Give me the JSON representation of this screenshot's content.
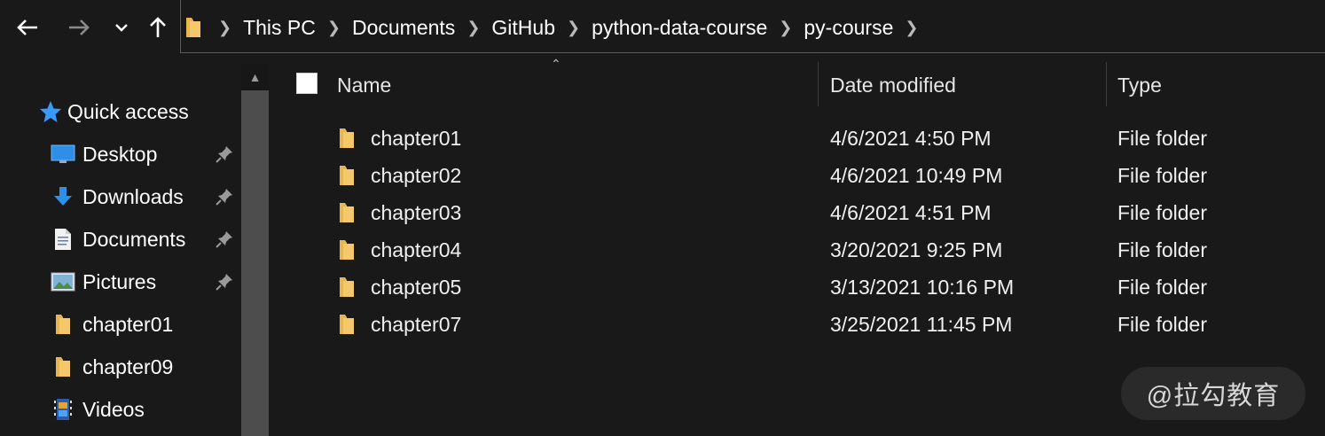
{
  "nav": {
    "back_icon": "back-arrow-icon",
    "forward_icon": "forward-arrow-icon",
    "recent_icon": "chevron-down-icon",
    "up_icon": "up-arrow-icon"
  },
  "breadcrumb": [
    "This PC",
    "Documents",
    "GitHub",
    "python-data-course",
    "py-course"
  ],
  "sidebar": {
    "quick_access": "Quick access",
    "items": [
      {
        "label": "Desktop",
        "icon": "desktop-icon",
        "pinned": true
      },
      {
        "label": "Downloads",
        "icon": "downloads-icon",
        "pinned": true
      },
      {
        "label": "Documents",
        "icon": "documents-icon",
        "pinned": true
      },
      {
        "label": "Pictures",
        "icon": "pictures-icon",
        "pinned": true
      },
      {
        "label": "chapter01",
        "icon": "folder-icon",
        "pinned": false
      },
      {
        "label": "chapter09",
        "icon": "folder-icon",
        "pinned": false
      },
      {
        "label": "Videos",
        "icon": "videos-icon",
        "pinned": false
      }
    ]
  },
  "columns": {
    "name": "Name",
    "date": "Date modified",
    "type": "Type"
  },
  "files": [
    {
      "name": "chapter01",
      "date": "4/6/2021 4:50 PM",
      "type": "File folder"
    },
    {
      "name": "chapter02",
      "date": "4/6/2021 10:49 PM",
      "type": "File folder"
    },
    {
      "name": "chapter03",
      "date": "4/6/2021 4:51 PM",
      "type": "File folder"
    },
    {
      "name": "chapter04",
      "date": "3/20/2021 9:25 PM",
      "type": "File folder"
    },
    {
      "name": "chapter05",
      "date": "3/13/2021 10:16 PM",
      "type": "File folder"
    },
    {
      "name": "chapter07",
      "date": "3/25/2021 11:45 PM",
      "type": "File folder"
    }
  ],
  "watermark": "@拉勾教育",
  "colors": {
    "background": "#191919",
    "folder": "#f5c96b",
    "accent": "#4aa3ff"
  }
}
